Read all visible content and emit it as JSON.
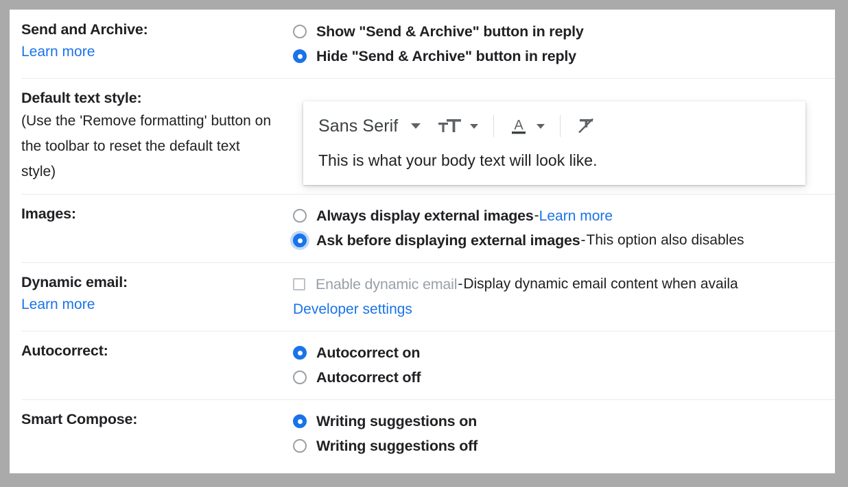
{
  "theme": {
    "page_background": "#aaaaaa",
    "panel_background": "#ffffff",
    "accent": "#1a73e8",
    "link": "#1a73e8",
    "text": "#202124",
    "disabled_text": "#9aa0a6",
    "divider": "#e8eaed"
  },
  "sections": {
    "send_and_archive": {
      "label": "Send and Archive:",
      "learn_more": "Learn more",
      "options": [
        {
          "label": "Show \"Send & Archive\" button in reply",
          "selected": false
        },
        {
          "label": "Hide \"Send & Archive\" button in reply",
          "selected": true
        }
      ]
    },
    "default_text_style": {
      "label": "Default text style:",
      "note_lines": [
        "(Use the 'Remove formatting' button on",
        "the toolbar to reset the default text",
        "style)"
      ],
      "popup": {
        "font_name": "Sans Serif",
        "font_dropdown_icon": "chevron-down-icon",
        "text_size_icon": "text-size-icon",
        "text_size_dropdown_icon": "chevron-down-icon",
        "text_color_icon": "text-color-icon",
        "text_color_dropdown_icon": "chevron-down-icon",
        "remove_formatting_icon": "remove-formatting-icon",
        "preview_text": "This is what your body text will look like."
      }
    },
    "images": {
      "label": "Images:",
      "options": [
        {
          "label": "Always display external images",
          "separator": " - ",
          "link": "Learn more",
          "selected": false,
          "focused": false
        },
        {
          "label": "Ask before displaying external images",
          "separator": " - ",
          "tail": "This option also disables",
          "selected": true,
          "focused": true
        }
      ]
    },
    "dynamic_email": {
      "label": "Dynamic email:",
      "learn_more": "Learn more",
      "checkbox": {
        "label": "Enable dynamic email",
        "checked": false,
        "disabled": true,
        "separator": " - ",
        "tail": "Display dynamic email content when availa"
      },
      "developer_settings": "Developer settings"
    },
    "autocorrect": {
      "label": "Autocorrect:",
      "options": [
        {
          "label": "Autocorrect on",
          "selected": true
        },
        {
          "label": "Autocorrect off",
          "selected": false
        }
      ]
    },
    "smart_compose": {
      "label": "Smart Compose:",
      "options": [
        {
          "label": "Writing suggestions on",
          "selected": true
        },
        {
          "label": "Writing suggestions off",
          "selected": false
        }
      ]
    }
  }
}
